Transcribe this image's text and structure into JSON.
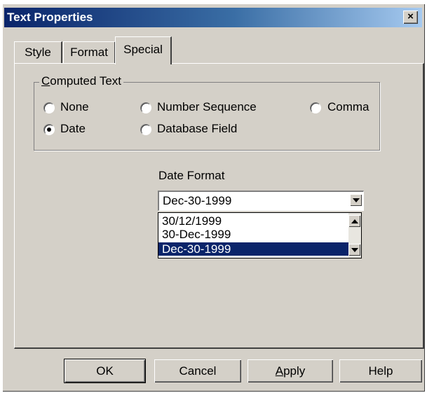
{
  "window": {
    "title": "Text Properties",
    "close_glyph": "×"
  },
  "tabs": [
    {
      "label": "Style",
      "active": false
    },
    {
      "label": "Format",
      "active": false
    },
    {
      "label": "Special",
      "active": true
    }
  ],
  "computed_text": {
    "group_label_first": "C",
    "group_label_rest": "omputed Text",
    "options": [
      {
        "label": "None",
        "selected": false
      },
      {
        "label": "Number Sequence",
        "selected": false
      },
      {
        "label": "Comma",
        "selected": false
      },
      {
        "label": "Date",
        "selected": true
      },
      {
        "label": "Database Field",
        "selected": false
      }
    ]
  },
  "date_format": {
    "label": "Date Format",
    "value": "Dec-30-1999",
    "options": [
      "30/12/1999",
      "30-Dec-1999",
      "Dec-30-1999"
    ],
    "selected_index": 2
  },
  "buttons": {
    "ok": "OK",
    "cancel": "Cancel",
    "apply_first": "A",
    "apply_rest": "pply",
    "help": "Help"
  }
}
